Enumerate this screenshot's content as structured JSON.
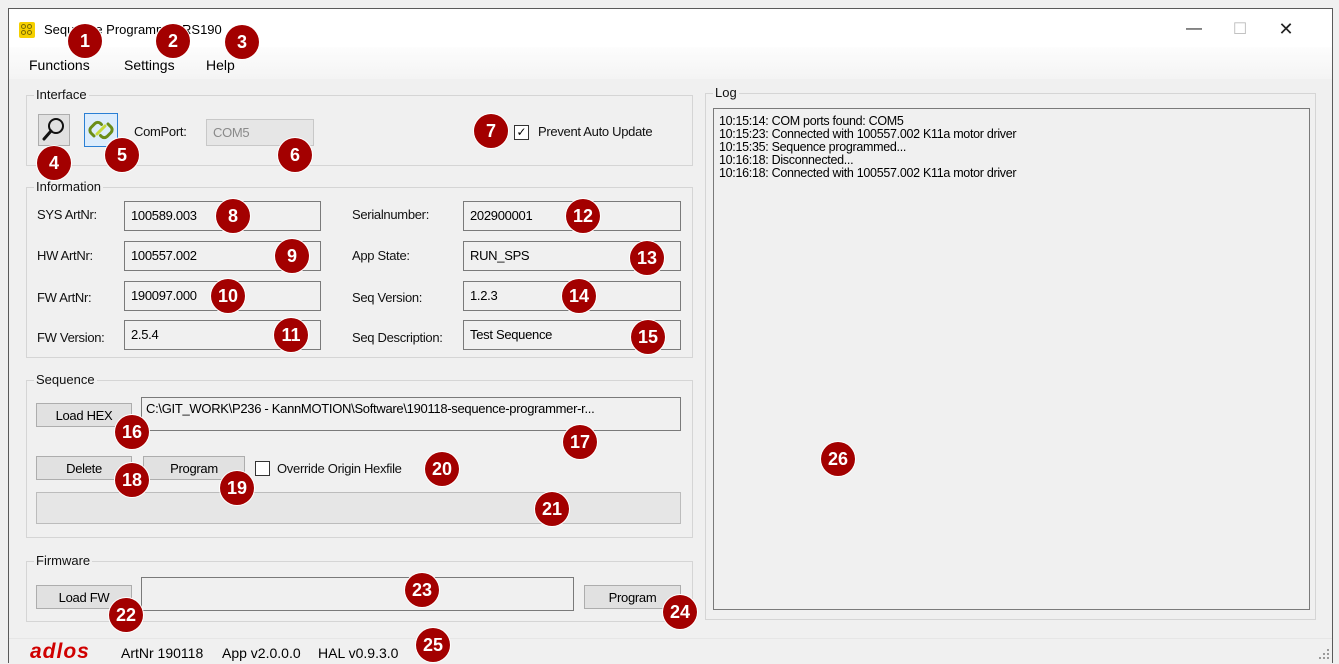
{
  "window": {
    "title": "Sequence Programmer RS190",
    "minimize": "—",
    "maximize": "☐",
    "close": "✕"
  },
  "menu": {
    "functions": "Functions",
    "settings": "Settings",
    "help": "Help"
  },
  "interface": {
    "group_label": "Interface",
    "search_icon": "magnifier",
    "connect_icon": "chain-link",
    "comport_label": "ComPort:",
    "comport_value": "COM5",
    "prevent_auto_update_label": "Prevent Auto Update",
    "prevent_auto_update_checked": "✓"
  },
  "information": {
    "group_label": "Information",
    "sys_artnr_label": "SYS ArtNr:",
    "sys_artnr_value": "100589.003",
    "hw_artnr_label": "HW ArtNr:",
    "hw_artnr_value": "100557.002",
    "fw_artnr_label": "FW ArtNr:",
    "fw_artnr_value": "190097.000",
    "fw_version_label": "FW Version:",
    "fw_version_value": "2.5.4",
    "serialnumber_label": "Serialnumber:",
    "serialnumber_value": "202900001",
    "app_state_label": "App State:",
    "app_state_value": "RUN_SPS",
    "seq_version_label": "Seq Version:",
    "seq_version_value": "1.2.3",
    "seq_description_label": "Seq Description:",
    "seq_description_value": "Test Sequence"
  },
  "sequence": {
    "group_label": "Sequence",
    "load_hex_button": "Load HEX",
    "hex_path": "C:\\GIT_WORK\\P236 - KannMOTION\\Software\\190118-sequence-programmer-r...",
    "delete_button": "Delete",
    "program_button": "Program",
    "override_label": "Override Origin Hexfile",
    "progress": 0
  },
  "firmware": {
    "group_label": "Firmware",
    "load_fw_button": "Load FW",
    "fw_path": "",
    "program_button": "Program"
  },
  "log": {
    "group_label": "Log",
    "lines": [
      "10:15:14: COM ports found: COM5",
      "10:15:23: Connected with 100557.002 K11a motor driver",
      "10:15:35: Sequence programmed...",
      "10:16:18: Disconnected...",
      "10:16:18: Connected with 100557.002 K11a motor driver"
    ]
  },
  "status": {
    "logo": "adlos",
    "artnr": "ArtNr 190118",
    "app_version": "App v2.0.0.0",
    "hal_version": "HAL v0.9.3.0"
  },
  "markers": [
    "1",
    "2",
    "3",
    "4",
    "5",
    "6",
    "7",
    "8",
    "9",
    "10",
    "11",
    "12",
    "13",
    "14",
    "15",
    "16",
    "17",
    "18",
    "19",
    "20",
    "21",
    "22",
    "23",
    "24",
    "25",
    "26"
  ],
  "colors": {
    "marker": "#a30000",
    "logo": "#d00000",
    "window_bg": "#f0f0f0"
  }
}
